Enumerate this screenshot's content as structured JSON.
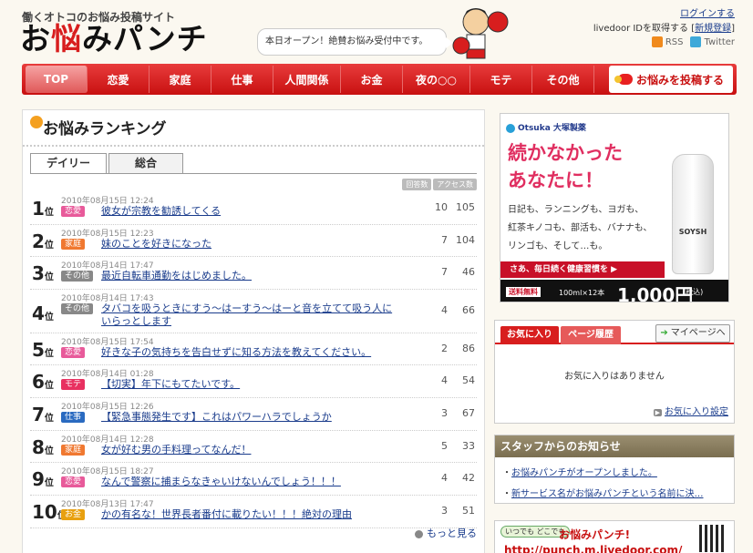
{
  "header": {
    "tagline": "働くオトコのお悩み投稿サイト",
    "logo_text_1": "お",
    "logo_text_2": "悩",
    "logo_text_3": "みパンチ",
    "announcement": "本日オープン！絶賛お悩み受付中です。",
    "login": "ログインする",
    "register_prefix": "livedoor IDを取得する [",
    "register_link": "新規登録",
    "register_suffix": "]",
    "rss": "RSS",
    "twitter": "Twitter"
  },
  "nav": {
    "items": [
      "TOP",
      "恋愛",
      "家庭",
      "仕事",
      "人間関係",
      "お金",
      "夜の○○",
      "モテ",
      "その他"
    ],
    "post_button": "お悩みを投稿する"
  },
  "ranking": {
    "title": "お悩みランキング",
    "tabs": [
      "デイリー",
      "総合"
    ],
    "col_answers": "回答数",
    "col_access": "アクセス数",
    "rank_suffix": "位",
    "rows": [
      {
        "rank": "1",
        "date": "2010年08月15日 12:24",
        "category": "恋愛",
        "cat_color": "#e85a9a",
        "title": "彼女が宗教を勧誘してくる",
        "answers": "10",
        "access": "105"
      },
      {
        "rank": "2",
        "date": "2010年08月15日 12:23",
        "category": "家庭",
        "cat_color": "#f07830",
        "title": "妹のことを好きになった",
        "answers": "7",
        "access": "104"
      },
      {
        "rank": "3",
        "date": "2010年08月14日 17:47",
        "category": "その他",
        "cat_color": "#888888",
        "title": "最近自転車通勤をはじめました。",
        "answers": "7",
        "access": "46"
      },
      {
        "rank": "4",
        "date": "2010年08月14日 17:43",
        "category": "その他",
        "cat_color": "#888888",
        "title": "タバコを吸うときにすう～はーすう～はーと音を立てて吸う人にいらっとします",
        "answers": "4",
        "access": "66"
      },
      {
        "rank": "5",
        "date": "2010年08月15日 17:54",
        "category": "恋愛",
        "cat_color": "#e85a9a",
        "title": "好きな子の気持ちを告白せずに知る方法を教えてください。",
        "answers": "2",
        "access": "86"
      },
      {
        "rank": "6",
        "date": "2010年08月14日 01:28",
        "category": "モテ",
        "cat_color": "#e83060",
        "title": "【切実】年下にもてたいです。",
        "answers": "4",
        "access": "54"
      },
      {
        "rank": "7",
        "date": "2010年08月15日 12:26",
        "category": "仕事",
        "cat_color": "#2a6ac0",
        "title": "【緊急事態発生です】これはパワーハラでしょうか",
        "answers": "3",
        "access": "67"
      },
      {
        "rank": "8",
        "date": "2010年08月14日 12:28",
        "category": "家庭",
        "cat_color": "#f07830",
        "title": "女が好む男の手料理ってなんだ！",
        "answers": "5",
        "access": "33"
      },
      {
        "rank": "9",
        "date": "2010年08月15日 18:27",
        "category": "恋愛",
        "cat_color": "#e85a9a",
        "title": "なんで警察に捕まらなきゃいけないんでしょう！！！",
        "answers": "4",
        "access": "42"
      },
      {
        "rank": "10",
        "date": "2010年08月13日 17:47",
        "category": "お金",
        "cat_color": "#e8a010",
        "title": "かの有名な！世界長者番付に載りたい！！！絶対の理由",
        "answers": "3",
        "access": "51"
      }
    ],
    "more": "もっと見る"
  },
  "ad": {
    "brand": "Otsuka 大塚製薬",
    "headline_1": "続かなかった",
    "headline_2": "あなたに！",
    "body_1": "日記も、ランニングも、ヨガも、",
    "body_2": "紅茶キノコも、部活も、バナナも、",
    "body_3": "リンゴも、そして…も。",
    "product": "SOYSH",
    "cta": "さあ、毎日続く健康習慣を ▶",
    "shipping": "送料無料",
    "qty": "100ml×12本",
    "price": "1,000円",
    "tax": "(税込)"
  },
  "favorites": {
    "tab_fav": "お気に入り",
    "tab_history": "ページ履歴",
    "mypage": "マイページへ",
    "empty": "お気に入りはありません",
    "settings": "お気に入り設定"
  },
  "staff": {
    "title": "スタッフからのお知らせ",
    "items": [
      "お悩みパンチがオープンしました。",
      "新サービス名がお悩みパンチという名前に決…"
    ]
  },
  "banner": {
    "tag": "いつでも どこでも",
    "title": "お悩みパンチ!",
    "url": "http://punch.m.livedoor.com/"
  }
}
